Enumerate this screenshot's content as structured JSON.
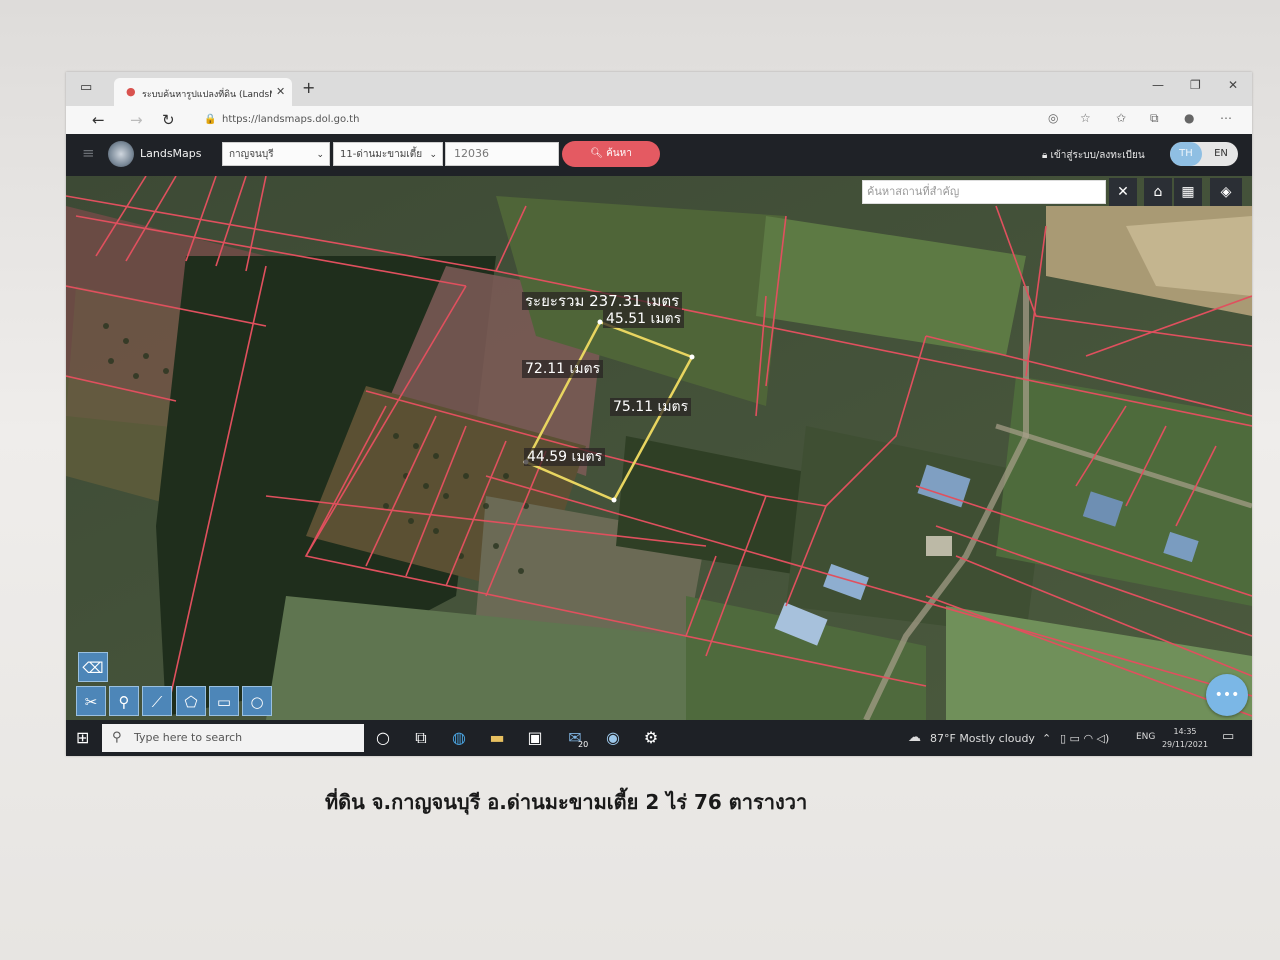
{
  "browser": {
    "tab_title": "ระบบค้นหารูปแปลงที่ดิน (LandsMaps)",
    "new_tab_icon": "+",
    "url": "https://landsmaps.dol.go.th"
  },
  "header": {
    "brand": "LandsMaps",
    "province": "กาญจนบุรี",
    "district": "11-ด่านมะขามเตี้ย",
    "parcel_no": "12036",
    "search_label": "ค้นหา",
    "login_label": "เข้าสู่ระบบ/ลงทะเบียน",
    "lang_th": "TH",
    "lang_en": "EN"
  },
  "map": {
    "place_search_placeholder": "ค้นหาสถานที่สำคัญ",
    "total_distance": "ระยะรวม 237.31 เมตร",
    "edges": {
      "top": "45.51 เมตร",
      "left": "72.11 เมตร",
      "right": "75.11 เมตร",
      "bottom": "44.59 เมตร"
    },
    "fab_label": "•••",
    "colors": {
      "parcel_line": "#e0505e",
      "measure_line": "#e8d560"
    }
  },
  "taskbar": {
    "search_placeholder": "Type here to search",
    "mail_badge": "20",
    "weather": "87°F Mostly cloudy",
    "lang": "ENG",
    "time": "14:35",
    "date": "29/11/2021"
  },
  "caption": "ที่ดิน จ.กาญจนบุรี อ.ด่านมะขามเตี้ย 2 ไร่ 76 ตารางวา"
}
